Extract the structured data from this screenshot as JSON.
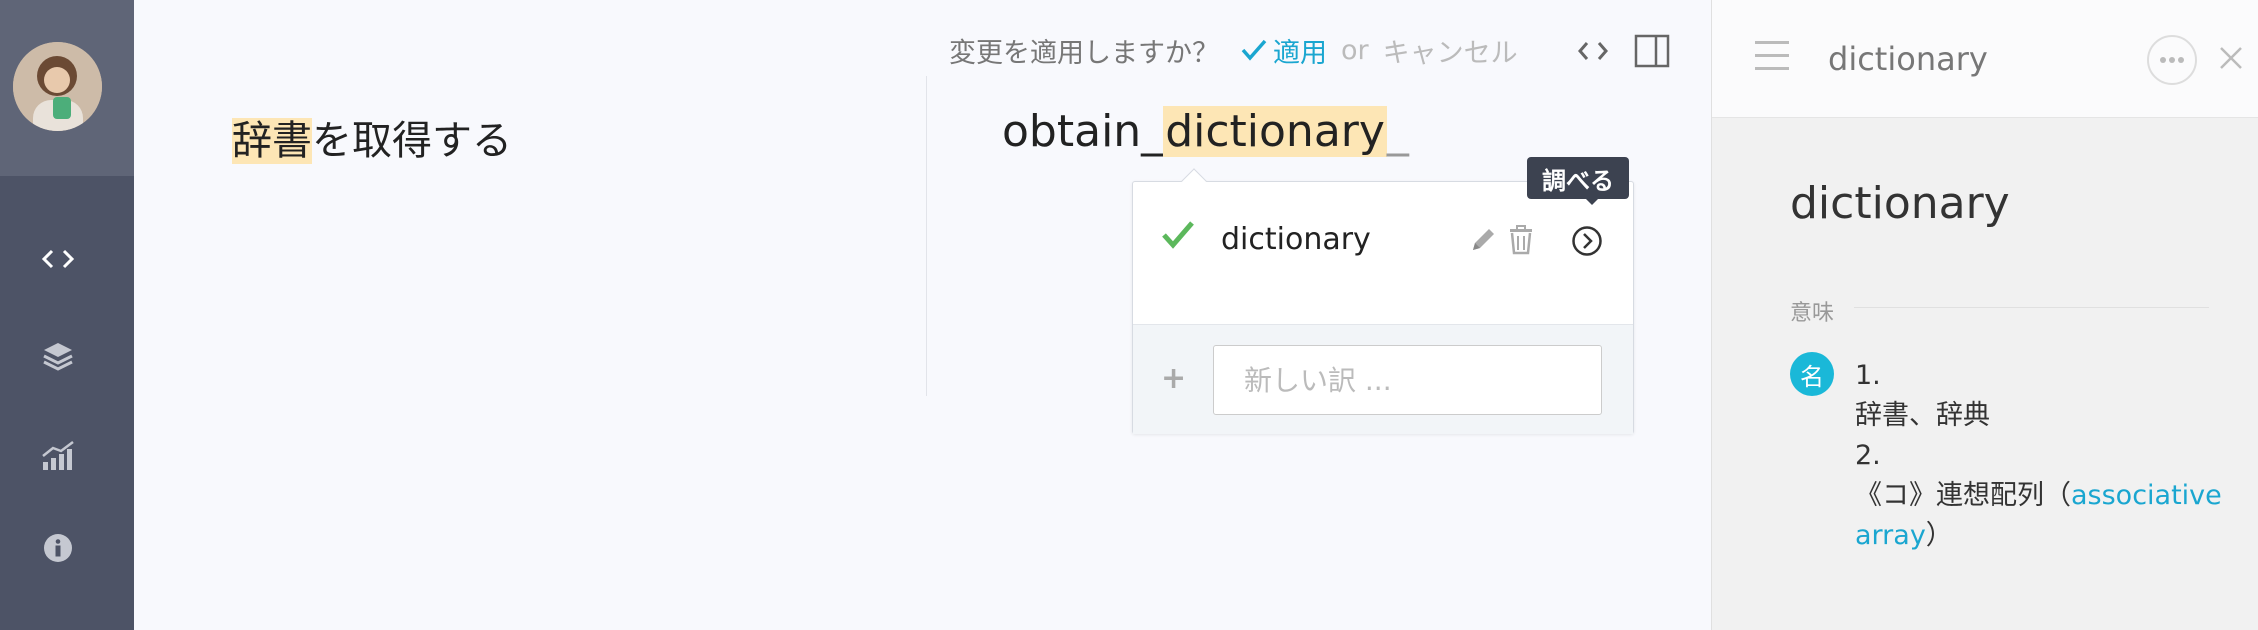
{
  "sidebar": {
    "items": [
      {
        "name": "code-icon"
      },
      {
        "name": "layers-icon"
      },
      {
        "name": "stats-icon"
      },
      {
        "name": "info-icon"
      }
    ]
  },
  "confirm_bar": {
    "question": "変更を適用しますか？",
    "apply_label": "適用",
    "or_label": "or",
    "cancel_label": "キャンセル"
  },
  "source": {
    "highlight": "辞書",
    "rest": "を取得する"
  },
  "target": {
    "prefix": "obtain_",
    "highlight": "dictionary",
    "suffix": "_"
  },
  "popup": {
    "suggestion": "dictionary",
    "new_placeholder": "新しい訳 ..."
  },
  "tooltip": {
    "label": "調べる"
  },
  "right_panel": {
    "title": "dictionary",
    "heading": "dictionary",
    "section_label": "意味",
    "pos_badge": "名",
    "def1_num": "1.",
    "def1_text": "辞書、辞典",
    "def2_num": "2.",
    "def2_prefix": "《コ》連想配列（",
    "def2_link": "associative array",
    "def2_suffix": "）"
  },
  "colors": {
    "accent": "#1aa6d0",
    "highlight": "#fde6b5",
    "sidebar_bg": "#4d5366",
    "check_green": "#5cb85c"
  }
}
